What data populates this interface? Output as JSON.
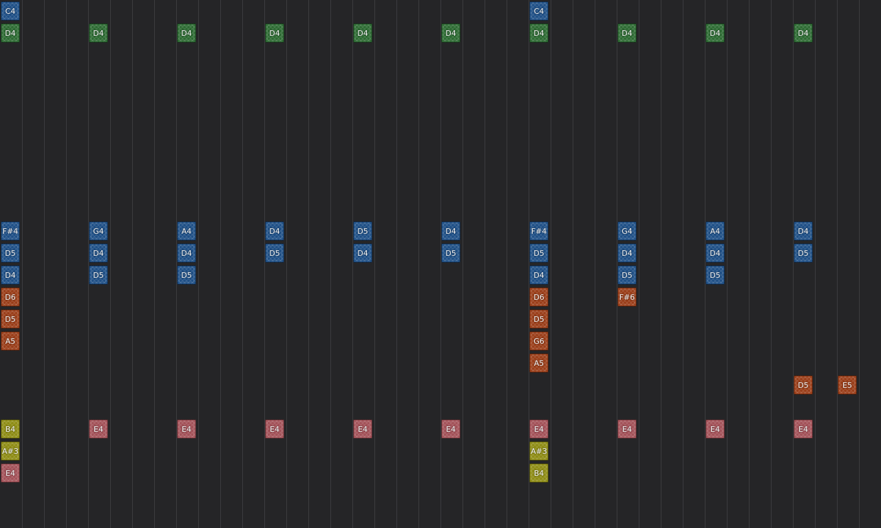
{
  "colors": {
    "blue": "#1e4f86",
    "green": "#2c6a32",
    "orange": "#9a3d18",
    "pink": "#a35158",
    "olive": "#8e8c14"
  },
  "columns": 40,
  "notes": [
    {
      "col": 0,
      "row": 0,
      "label": "C4",
      "color": "blue"
    },
    {
      "col": 24,
      "row": 0,
      "label": "C4",
      "color": "blue"
    },
    {
      "col": 0,
      "row": 1,
      "label": "D4",
      "color": "green"
    },
    {
      "col": 4,
      "row": 1,
      "label": "D4",
      "color": "green"
    },
    {
      "col": 8,
      "row": 1,
      "label": "D4",
      "color": "green"
    },
    {
      "col": 12,
      "row": 1,
      "label": "D4",
      "color": "green"
    },
    {
      "col": 16,
      "row": 1,
      "label": "D4",
      "color": "green"
    },
    {
      "col": 20,
      "row": 1,
      "label": "D4",
      "color": "green"
    },
    {
      "col": 24,
      "row": 1,
      "label": "D4",
      "color": "green"
    },
    {
      "col": 28,
      "row": 1,
      "label": "D4",
      "color": "green"
    },
    {
      "col": 32,
      "row": 1,
      "label": "D4",
      "color": "green"
    },
    {
      "col": 36,
      "row": 1,
      "label": "D4",
      "color": "green"
    },
    {
      "col": 0,
      "row": 10,
      "label": "F#4",
      "color": "blue"
    },
    {
      "col": 4,
      "row": 10,
      "label": "G4",
      "color": "blue"
    },
    {
      "col": 8,
      "row": 10,
      "label": "A4",
      "color": "blue"
    },
    {
      "col": 12,
      "row": 10,
      "label": "D4",
      "color": "blue"
    },
    {
      "col": 16,
      "row": 10,
      "label": "D5",
      "color": "blue"
    },
    {
      "col": 20,
      "row": 10,
      "label": "D4",
      "color": "blue"
    },
    {
      "col": 24,
      "row": 10,
      "label": "F#4",
      "color": "blue"
    },
    {
      "col": 28,
      "row": 10,
      "label": "G4",
      "color": "blue"
    },
    {
      "col": 32,
      "row": 10,
      "label": "A4",
      "color": "blue"
    },
    {
      "col": 36,
      "row": 10,
      "label": "D4",
      "color": "blue"
    },
    {
      "col": 0,
      "row": 11,
      "label": "D5",
      "color": "blue"
    },
    {
      "col": 4,
      "row": 11,
      "label": "D4",
      "color": "blue"
    },
    {
      "col": 8,
      "row": 11,
      "label": "D4",
      "color": "blue"
    },
    {
      "col": 12,
      "row": 11,
      "label": "D5",
      "color": "blue"
    },
    {
      "col": 16,
      "row": 11,
      "label": "D4",
      "color": "blue"
    },
    {
      "col": 20,
      "row": 11,
      "label": "D5",
      "color": "blue"
    },
    {
      "col": 24,
      "row": 11,
      "label": "D5",
      "color": "blue"
    },
    {
      "col": 28,
      "row": 11,
      "label": "D4",
      "color": "blue"
    },
    {
      "col": 32,
      "row": 11,
      "label": "D4",
      "color": "blue"
    },
    {
      "col": 36,
      "row": 11,
      "label": "D5",
      "color": "blue"
    },
    {
      "col": 0,
      "row": 12,
      "label": "D4",
      "color": "blue"
    },
    {
      "col": 4,
      "row": 12,
      "label": "D5",
      "color": "blue"
    },
    {
      "col": 8,
      "row": 12,
      "label": "D5",
      "color": "blue"
    },
    {
      "col": 24,
      "row": 12,
      "label": "D4",
      "color": "blue"
    },
    {
      "col": 28,
      "row": 12,
      "label": "D5",
      "color": "blue"
    },
    {
      "col": 32,
      "row": 12,
      "label": "D5",
      "color": "blue"
    },
    {
      "col": 0,
      "row": 13,
      "label": "D6",
      "color": "orange"
    },
    {
      "col": 24,
      "row": 13,
      "label": "D6",
      "color": "orange"
    },
    {
      "col": 28,
      "row": 13,
      "label": "F#6",
      "color": "orange"
    },
    {
      "col": 0,
      "row": 14,
      "label": "D5",
      "color": "orange"
    },
    {
      "col": 24,
      "row": 14,
      "label": "D5",
      "color": "orange"
    },
    {
      "col": 0,
      "row": 15,
      "label": "A5",
      "color": "orange"
    },
    {
      "col": 24,
      "row": 15,
      "label": "G6",
      "color": "orange"
    },
    {
      "col": 24,
      "row": 16,
      "label": "A5",
      "color": "orange"
    },
    {
      "col": 36,
      "row": 17,
      "label": "D5",
      "color": "orange"
    },
    {
      "col": 38,
      "row": 17,
      "label": "E5",
      "color": "orange"
    },
    {
      "col": 0,
      "row": 19,
      "label": "B4",
      "color": "olive"
    },
    {
      "col": 4,
      "row": 19,
      "label": "E4",
      "color": "pink"
    },
    {
      "col": 8,
      "row": 19,
      "label": "E4",
      "color": "pink"
    },
    {
      "col": 12,
      "row": 19,
      "label": "E4",
      "color": "pink"
    },
    {
      "col": 16,
      "row": 19,
      "label": "E4",
      "color": "pink"
    },
    {
      "col": 20,
      "row": 19,
      "label": "E4",
      "color": "pink"
    },
    {
      "col": 24,
      "row": 19,
      "label": "E4",
      "color": "pink"
    },
    {
      "col": 28,
      "row": 19,
      "label": "E4",
      "color": "pink"
    },
    {
      "col": 32,
      "row": 19,
      "label": "E4",
      "color": "pink"
    },
    {
      "col": 36,
      "row": 19,
      "label": "E4",
      "color": "pink"
    },
    {
      "col": 0,
      "row": 20,
      "label": "A#3",
      "color": "olive"
    },
    {
      "col": 24,
      "row": 20,
      "label": "A#3",
      "color": "olive"
    },
    {
      "col": 0,
      "row": 21,
      "label": "E4",
      "color": "pink"
    },
    {
      "col": 24,
      "row": 21,
      "label": "B4",
      "color": "olive"
    }
  ]
}
